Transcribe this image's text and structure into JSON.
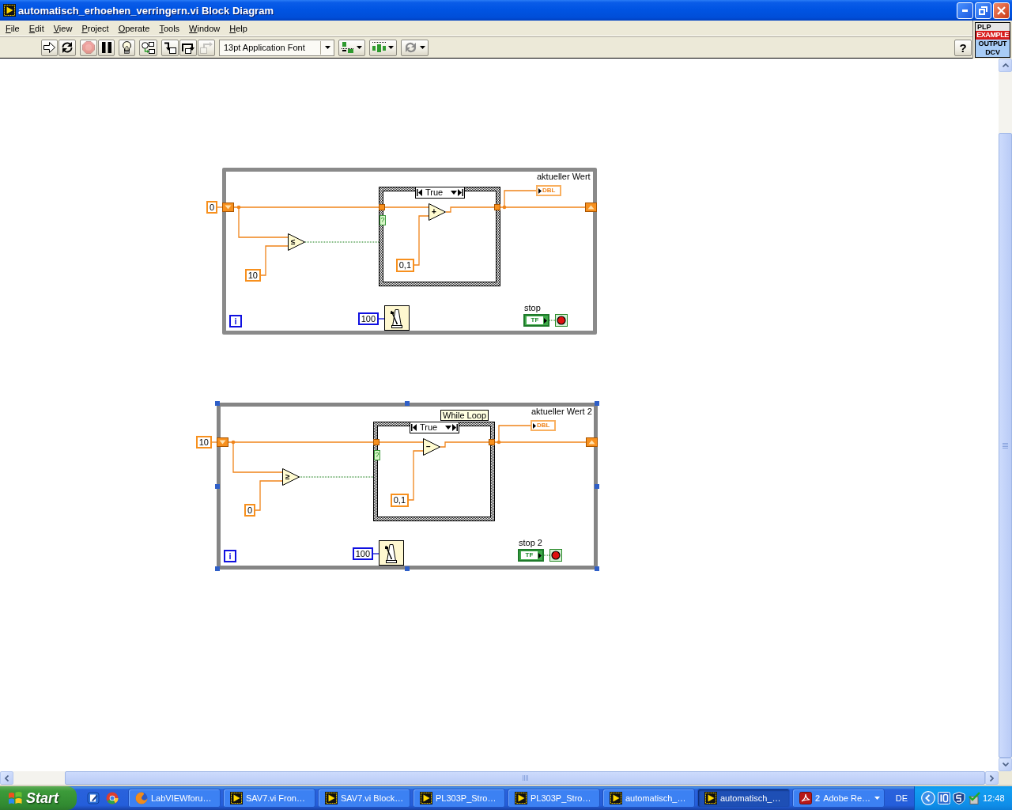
{
  "window": {
    "title": "automatisch_erhoehen_verringern.vi Block Diagram"
  },
  "menu": [
    "File",
    "Edit",
    "View",
    "Project",
    "Operate",
    "Tools",
    "Window",
    "Help"
  ],
  "toolbar": {
    "groups": [
      {
        "buttons": [
          {
            "kind": "run",
            "disabled": false
          },
          {
            "kind": "run_continuously",
            "disabled": false
          }
        ]
      },
      {
        "buttons": [
          {
            "kind": "abort",
            "disabled": true
          },
          {
            "kind": "pause",
            "disabled": false
          }
        ]
      },
      {
        "buttons": [
          {
            "kind": "highlight_execution",
            "disabled": false
          }
        ]
      },
      {
        "buttons": [
          {
            "kind": "retain_wire_values",
            "disabled": false
          }
        ]
      },
      {
        "buttons": [
          {
            "kind": "step_into",
            "disabled": false
          },
          {
            "kind": "step_over",
            "disabled": false
          },
          {
            "kind": "step_out",
            "disabled": true
          }
        ]
      }
    ],
    "font": "13pt Application Font",
    "tools": [
      {
        "kind": "align"
      },
      {
        "kind": "distribute"
      },
      {
        "kind": "reorder"
      }
    ],
    "help": "?"
  },
  "vi_icon": {
    "lines": [
      {
        "text": "PLP",
        "kind": "plain"
      },
      {
        "text": "EXAMPLE",
        "kind": "banner"
      },
      {
        "text": "OUTPUT",
        "kind": "tinted"
      },
      {
        "text": "DCV",
        "kind": "tinted"
      }
    ]
  },
  "diagram": {
    "loops": [
      {
        "selected": false,
        "initial_value": "0",
        "comparison": "≤",
        "limit": "10",
        "selector_terminal": "?",
        "case_value": "True",
        "operator": "+",
        "step": "0,1",
        "indicator_label": "aktueller Wert",
        "indicator_type": "DBL",
        "wait_ms": "100",
        "iteration": "i",
        "stop_label": "stop",
        "stop_type": "TF"
      },
      {
        "selected": true,
        "tooltip": "While Loop",
        "initial_value": "10",
        "comparison": "≥",
        "limit": "0",
        "selector_terminal": "?",
        "case_value": "True",
        "operator": "−",
        "step": "0,1",
        "indicator_label": "aktueller Wert 2",
        "indicator_type": "DBL",
        "wait_ms": "100",
        "iteration": "i",
        "stop_label": "stop 2",
        "stop_type": "TF"
      }
    ]
  },
  "taskbar": {
    "start": "Start",
    "tasks": [
      {
        "label": "LabVIEWforu…",
        "kind": "browser",
        "selected": false
      },
      {
        "label": "SAV7.vi Fron…",
        "kind": "vi",
        "selected": false
      },
      {
        "label": "SAV7.vi Block…",
        "kind": "vi",
        "selected": false
      },
      {
        "label": "PL303P_Stro…",
        "kind": "vi",
        "selected": false
      },
      {
        "label": "PL303P_Stro…",
        "kind": "vi",
        "selected": false
      },
      {
        "label": "automatisch_…",
        "kind": "vi",
        "selected": false
      },
      {
        "label": "automatisch_…",
        "kind": "vi",
        "selected": true
      },
      {
        "count": "2",
        "label": "Adobe Re…",
        "kind": "pdf",
        "selected": false
      }
    ],
    "language": "DE",
    "clock": "12:48"
  }
}
